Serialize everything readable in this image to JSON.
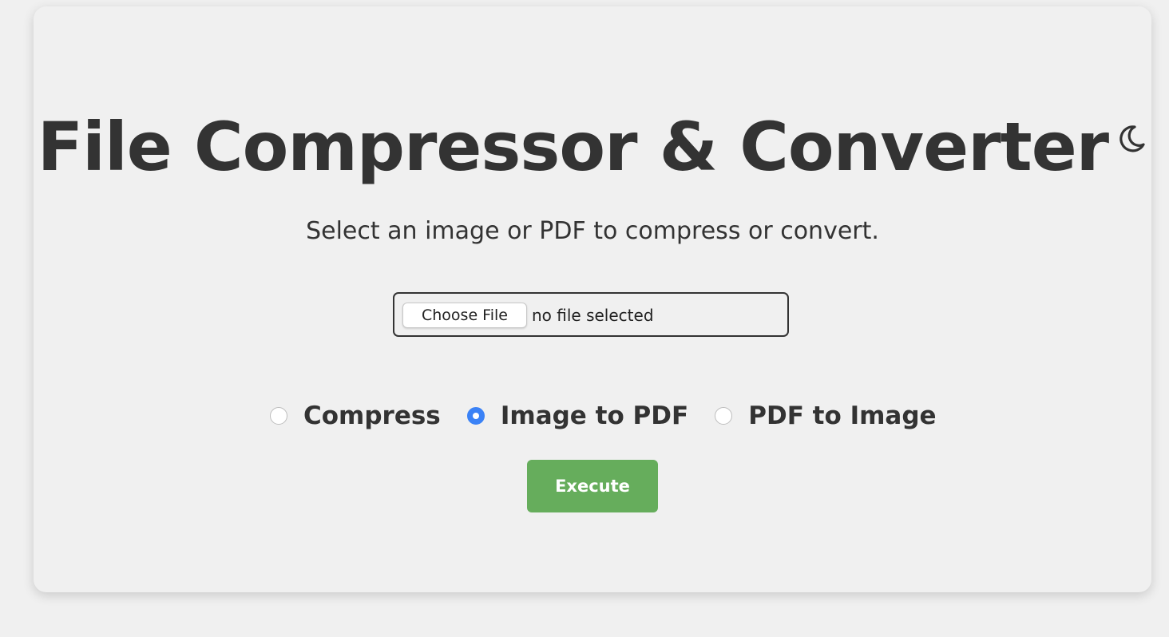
{
  "header": {
    "title": "File Compressor & Converter",
    "theme_toggle_icon": "moon-icon"
  },
  "subtitle": "Select an image or PDF to compress or convert.",
  "file_input": {
    "button_label": "Choose File",
    "status": "no file selected"
  },
  "options": [
    {
      "label": "Compress",
      "checked": false
    },
    {
      "label": "Image to PDF",
      "checked": true
    },
    {
      "label": "PDF to Image",
      "checked": false
    }
  ],
  "execute_label": "Execute",
  "colors": {
    "accent": "#3b82f6",
    "execute_button": "#66ad5c",
    "text": "#333333",
    "background": "#f0f0f0"
  }
}
